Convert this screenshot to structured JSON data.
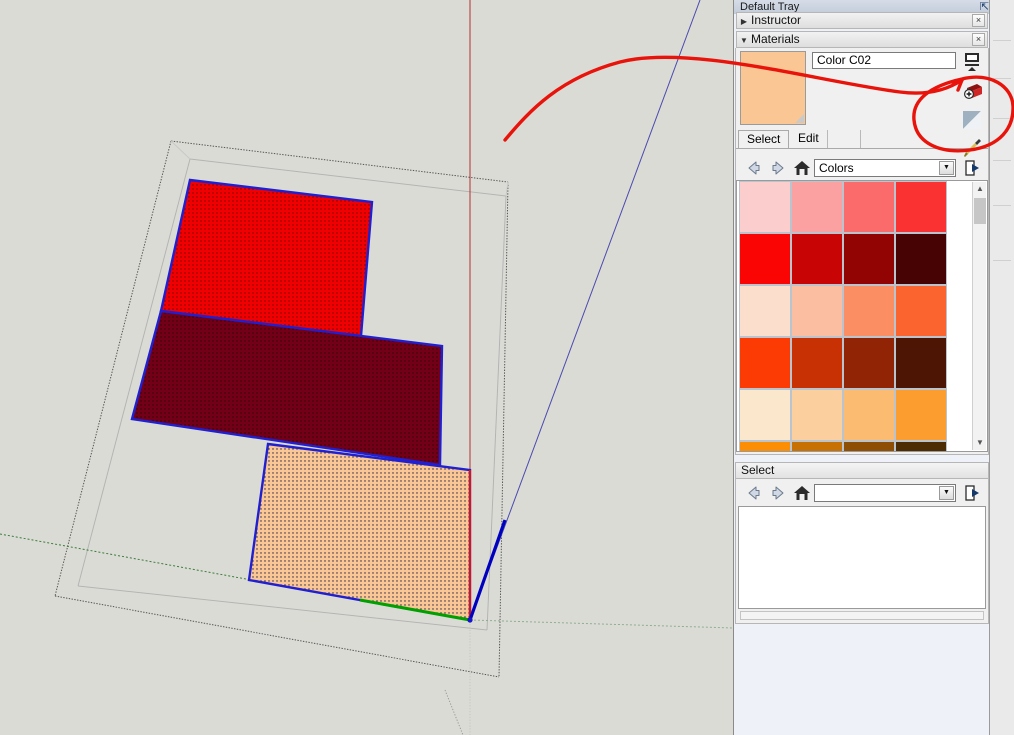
{
  "tray": {
    "title": "Default Tray",
    "pin_icon": "pin-icon",
    "close_label": "✕",
    "panels": [
      {
        "name": "Instructor",
        "expanded": false,
        "triangle": "▶",
        "close_label": "×"
      },
      {
        "name": "Materials",
        "expanded": true,
        "triangle": "▼",
        "close_label": "×"
      }
    ]
  },
  "materials": {
    "preview_color": "#F9C694",
    "material_name": "Color C02",
    "icons": [
      {
        "name": "display-secondary-selection-pane-icon"
      },
      {
        "name": "create-material-icon"
      },
      {
        "name": "set-material-to-default-icon"
      },
      {
        "name": "sample-paint-icon"
      }
    ],
    "tabs": [
      {
        "label": "Select",
        "active": true
      },
      {
        "label": "Edit",
        "active": false
      }
    ],
    "nav": {
      "back_icon": "back-arrow-icon",
      "forward_icon": "forward-arrow-icon",
      "home_icon": "home-icon",
      "library_value": "Colors",
      "details_icon": "details-arrow-icon"
    },
    "swatches": [
      [
        "#FBCDCD",
        "#FBA1A1",
        "#FB6B6B",
        "#FA3232"
      ],
      [
        "#FB0404",
        "#C90404",
        "#920404",
        "#470303"
      ],
      [
        "#FBDECC",
        "#FBBEA0",
        "#FB8F63",
        "#FB632F"
      ],
      [
        "#FB3A04",
        "#C73104",
        "#902404",
        "#4D1503"
      ],
      [
        "#FBE7CC",
        "#FBD09E",
        "#FBBB71",
        "#FB9E2F"
      ],
      [
        "#FB8E04",
        "#C77004",
        "#8E4F04",
        "#4D2B03"
      ]
    ],
    "scrollbar": {
      "up": "▲",
      "down": "▼"
    }
  },
  "select_panel": {
    "title": "Select",
    "nav": {
      "back_icon": "back-arrow-icon",
      "forward_icon": "forward-arrow-icon",
      "home_icon": "home-icon",
      "combo_value": "",
      "details_icon": "details-arrow-icon"
    }
  },
  "viewport": {
    "background": "#DBDBD6",
    "axis_red": "#C01010",
    "axis_green": "#0E8A0E",
    "axis_blue": "#2828A0",
    "selection_edge": "#2020D0",
    "faces": [
      {
        "name": "face-red-top",
        "fill": "#F00000"
      },
      {
        "name": "face-dark-red-middle",
        "fill": "#730016"
      },
      {
        "name": "face-peach-bottom",
        "fill": "#F9C694"
      }
    ],
    "bounding_box_color": "#555555"
  },
  "annotation": {
    "color": "#E8130A",
    "shapes": [
      "arrow-to-create-material",
      "circle-around-material-icons"
    ]
  }
}
